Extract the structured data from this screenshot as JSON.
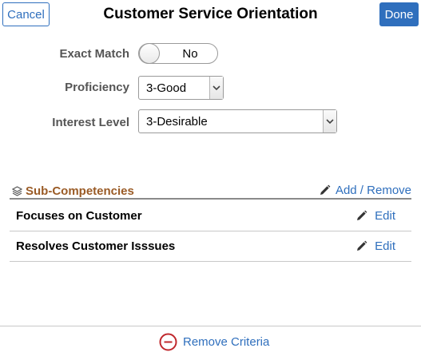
{
  "header": {
    "cancel_label": "Cancel",
    "title": "Customer Service Orientation",
    "done_label": "Done"
  },
  "form": {
    "exact_match": {
      "label": "Exact Match",
      "value": "No"
    },
    "proficiency": {
      "label": "Proficiency",
      "value": "3-Good"
    },
    "interest_level": {
      "label": "Interest Level",
      "value": "3-Desirable"
    }
  },
  "subcompetencies": {
    "title": "Sub-Competencies",
    "add_remove_label": "Add / Remove",
    "items": [
      {
        "label": "Focuses on Customer",
        "action": "Edit"
      },
      {
        "label": "Resolves Customer Isssues",
        "action": "Edit"
      }
    ]
  },
  "footer": {
    "remove_label": "Remove Criteria"
  },
  "colors": {
    "accent": "#2f6fbd",
    "section_title": "#9a5b26",
    "danger": "#c0282d"
  }
}
